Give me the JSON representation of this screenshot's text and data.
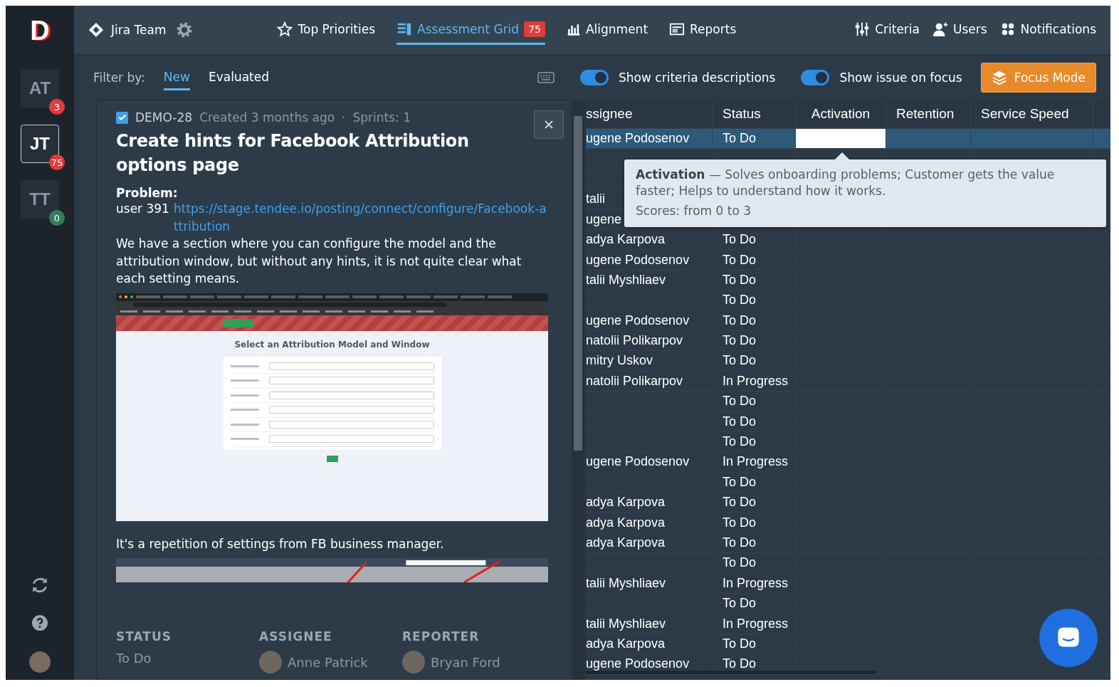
{
  "sidebar": {
    "logo": "D",
    "teams": [
      {
        "initials": "AT",
        "badge": "3",
        "color": "#e03c3c",
        "selected": false
      },
      {
        "initials": "JT",
        "badge": "75",
        "color": "#e03c3c",
        "selected": true
      },
      {
        "initials": "TT",
        "badge": "0",
        "color": "#2e7d5b",
        "selected": false
      }
    ]
  },
  "topbar": {
    "team": "Jira Team",
    "nav": [
      {
        "label": "Top Priorities",
        "selected": false
      },
      {
        "label": "Assessment Grid",
        "badge": "75",
        "selected": true
      },
      {
        "label": "Alignment",
        "selected": false
      },
      {
        "label": "Reports",
        "selected": false
      }
    ],
    "right_nav": [
      "Criteria",
      "Users",
      "Notifications"
    ]
  },
  "filter": {
    "label": "Filter by:",
    "tabs": [
      {
        "label": "New",
        "selected": true
      },
      {
        "label": "Evaluated",
        "selected": false
      }
    ]
  },
  "toggles": [
    {
      "label": "Show criteria descriptions",
      "on": true
    },
    {
      "label": "Show issue on focus",
      "on": true
    }
  ],
  "focus_button": "Focus Mode",
  "issue": {
    "checked": true,
    "key": "DEMO-28",
    "created": "Created 3 months ago",
    "separator": "·",
    "sprints": "Sprints: 1",
    "title": "Create hints for Facebook Attribution options page",
    "problem_label": "Problem:",
    "user": "user 391",
    "link": "https://stage.tendee.io/posting/connect/configure/Facebook-attribution",
    "description": "We have a section where you can configure the model and the attribution window, but without any hints, it is not quite clear what each setting means.",
    "screenshot": {
      "heading": "Select an Attribution Model and Window"
    },
    "note": "It's a repetition of settings from FB business manager.",
    "footer": [
      {
        "label": "STATUS",
        "value": "To Do",
        "avatar": false
      },
      {
        "label": "ASSIGNEE",
        "value": "Anne Patrick",
        "avatar": true
      },
      {
        "label": "REPORTER",
        "value": "Bryan Ford",
        "avatar": true
      }
    ]
  },
  "grid": {
    "columns": [
      "ssignee",
      "Status",
      "Activation",
      "Retention",
      "Service Speed"
    ],
    "rows": [
      {
        "assignee": "ugene Podosenov",
        "status": "To Do",
        "selected": true
      },
      {
        "selected": false
      },
      {
        "selected": false
      },
      {
        "assignee": "talii",
        "selected": false
      },
      {
        "assignee": "ugene",
        "selected": false
      },
      {
        "assignee": "adya Karpova",
        "status": "To Do",
        "selected": false
      },
      {
        "assignee": "ugene Podosenov",
        "status": "To Do",
        "selected": false
      },
      {
        "assignee": "talii Myshliaev",
        "status": "To Do",
        "selected": false
      },
      {
        "status": "To Do",
        "selected": false
      },
      {
        "assignee": "ugene Podosenov",
        "status": "To Do",
        "selected": false
      },
      {
        "assignee": "natolii Polikarpov",
        "status": "To Do",
        "selected": false
      },
      {
        "assignee": "mitry Uskov",
        "status": "To Do",
        "selected": false
      },
      {
        "assignee": "natolii Polikarpov",
        "status": "In Progress",
        "selected": false
      },
      {
        "status": "To Do",
        "selected": false
      },
      {
        "status": "To Do",
        "selected": false
      },
      {
        "status": "To Do",
        "selected": false
      },
      {
        "assignee": "ugene Podosenov",
        "status": "In Progress",
        "selected": false
      },
      {
        "status": "To Do",
        "selected": false
      },
      {
        "assignee": "adya Karpova",
        "status": "To Do",
        "selected": false
      },
      {
        "assignee": "adya Karpova",
        "status": "To Do",
        "selected": false
      },
      {
        "assignee": "adya Karpova",
        "status": "To Do",
        "selected": false
      },
      {
        "status": "To Do",
        "selected": false
      },
      {
        "assignee": "talii Myshliaev",
        "status": "In Progress",
        "selected": false
      },
      {
        "status": "To Do",
        "selected": false
      },
      {
        "assignee": "talii Myshliaev",
        "status": "In Progress",
        "selected": false
      },
      {
        "assignee": "adya Karpova",
        "status": "To Do",
        "selected": false
      },
      {
        "assignee": "ugene Podosenov",
        "status": "To Do",
        "selected": false
      }
    ]
  },
  "tooltip": {
    "text": "**Activation** — Solves onboarding problems; Customer gets the value faster; Helps to understand how it works.",
    "scores": "Scores: from 0 to 3"
  }
}
